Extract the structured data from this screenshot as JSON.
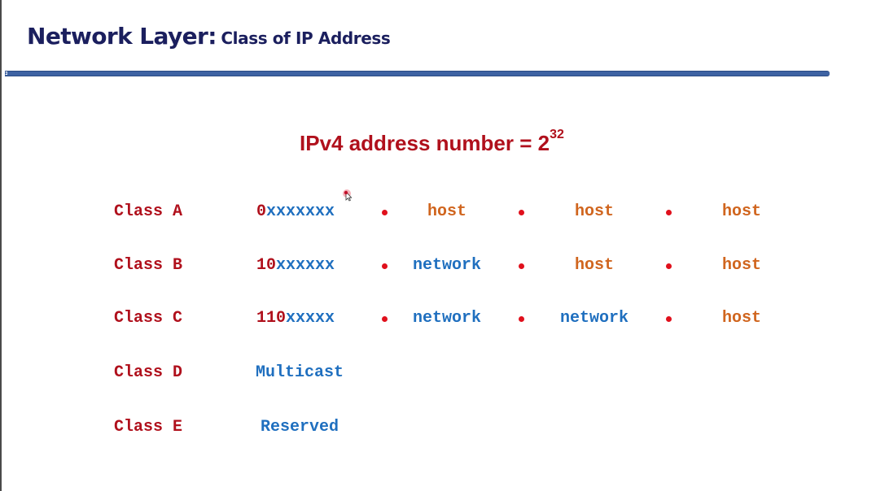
{
  "slide": {
    "title_main": "Network Layer:",
    "title_sub": "Class of IP Address",
    "formula_text": "IPv4 address number = 2",
    "formula_exponent": "32"
  },
  "colors": {
    "title": "#1b1f5e",
    "rule": "#3e63a3",
    "class_label": "#b0101c",
    "network": "#1f6fbf",
    "host": "#d0651e",
    "separator_dot": "#e0101c"
  },
  "classes": [
    {
      "label": "Class A",
      "prefix": "0",
      "bits": "xxxxxxx",
      "octets": [
        "host",
        "host",
        "host"
      ]
    },
    {
      "label": "Class B",
      "prefix": "10",
      "bits": "xxxxxx",
      "octets": [
        "network",
        "host",
        "host"
      ]
    },
    {
      "label": "Class C",
      "prefix": "110",
      "bits": "xxxxx",
      "octets": [
        "network",
        "network",
        "host"
      ]
    },
    {
      "label": "Class D",
      "description": "Multicast"
    },
    {
      "label": "Class E",
      "description": "Reserved"
    }
  ],
  "icons": {
    "cursor": "mouse-pointer-icon",
    "separator": "bullet-dot"
  }
}
